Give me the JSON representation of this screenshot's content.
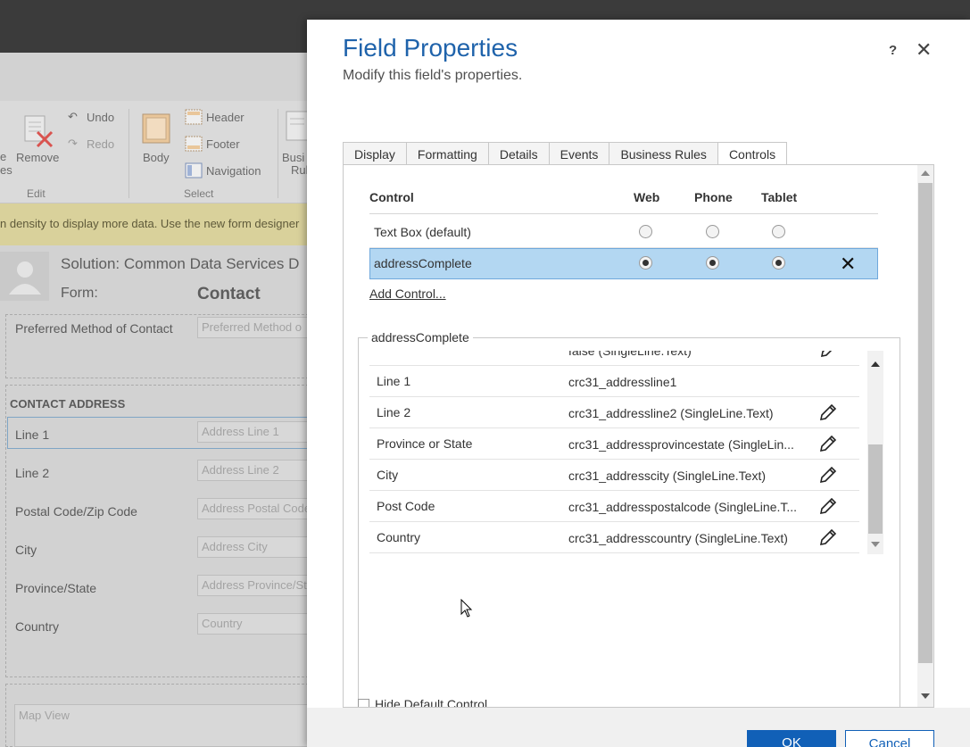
{
  "background": {
    "ribbon": {
      "remove_label": "Remove",
      "undo_label": "Undo",
      "redo_label": "Redo",
      "edit_group": "Edit",
      "body_label": "Body",
      "header_label": "Header",
      "footer_label": "Footer",
      "navigation_label": "Navigation",
      "select_group": "Select",
      "partial_left": "e",
      "partial_left2": "es",
      "partial_right": "Busi",
      "partial_right2": "Rul"
    },
    "notice": "n density to display more data. Use the new form designer",
    "solution_text": "Solution: Common Data Services D",
    "form_label": "Form:",
    "form_name": "Contact",
    "preferred_label": "Preferred Method of Contact",
    "preferred_placeholder": "Preferred Method o",
    "section_title": "CONTACT ADDRESS",
    "fields": [
      {
        "label": "Line 1",
        "placeholder": "Address Line 1"
      },
      {
        "label": "Line 2",
        "placeholder": "Address Line 2"
      },
      {
        "label": "Postal Code/Zip Code",
        "placeholder": "Address Postal Code"
      },
      {
        "label": "City",
        "placeholder": "Address City"
      },
      {
        "label": "Province/State",
        "placeholder": "Address Province/St"
      },
      {
        "label": "Country",
        "placeholder": "Country"
      }
    ],
    "map_view": "Map View"
  },
  "dialog": {
    "title": "Field Properties",
    "subtitle": "Modify this field's properties.",
    "help": "?",
    "close": "✕",
    "tabs": [
      "Display",
      "Formatting",
      "Details",
      "Events",
      "Business Rules",
      "Controls"
    ],
    "active_tab": "Controls",
    "controls_table": {
      "headers": {
        "control": "Control",
        "web": "Web",
        "phone": "Phone",
        "tablet": "Tablet"
      },
      "rows": [
        {
          "name": "Text Box (default)",
          "web": false,
          "phone": false,
          "tablet": false,
          "selected": false
        },
        {
          "name": "addressComplete",
          "web": true,
          "phone": true,
          "tablet": true,
          "selected": true
        }
      ],
      "delete_glyph": "✕",
      "add_control": "Add Control..."
    },
    "properties": {
      "legend": "addressComplete",
      "partial_row": {
        "name": "",
        "value": "false (SingleLine.Text)"
      },
      "rows": [
        {
          "name": "Line 1",
          "value": "crc31_addressline1",
          "editable": false
        },
        {
          "name": "Line 2",
          "value": "crc31_addressline2 (SingleLine.Text)",
          "editable": true
        },
        {
          "name": "Province or State",
          "value": "crc31_addressprovincestate (SingleLin...",
          "editable": true
        },
        {
          "name": "City",
          "value": "crc31_addresscity (SingleLine.Text)",
          "editable": true
        },
        {
          "name": "Post Code",
          "value": "crc31_addresspostalcode (SingleLine.T...",
          "editable": true
        },
        {
          "name": "Country",
          "value": "crc31_addresscountry (SingleLine.Text)",
          "editable": true
        }
      ],
      "hide_default": "Hide Default Control"
    },
    "ok": "OK",
    "cancel": "Cancel"
  },
  "colors": {
    "title_blue": "#1f63ab",
    "selection": "#b3d7f2",
    "primary_button": "#1160b7",
    "notice_bg": "#d9d19b"
  }
}
